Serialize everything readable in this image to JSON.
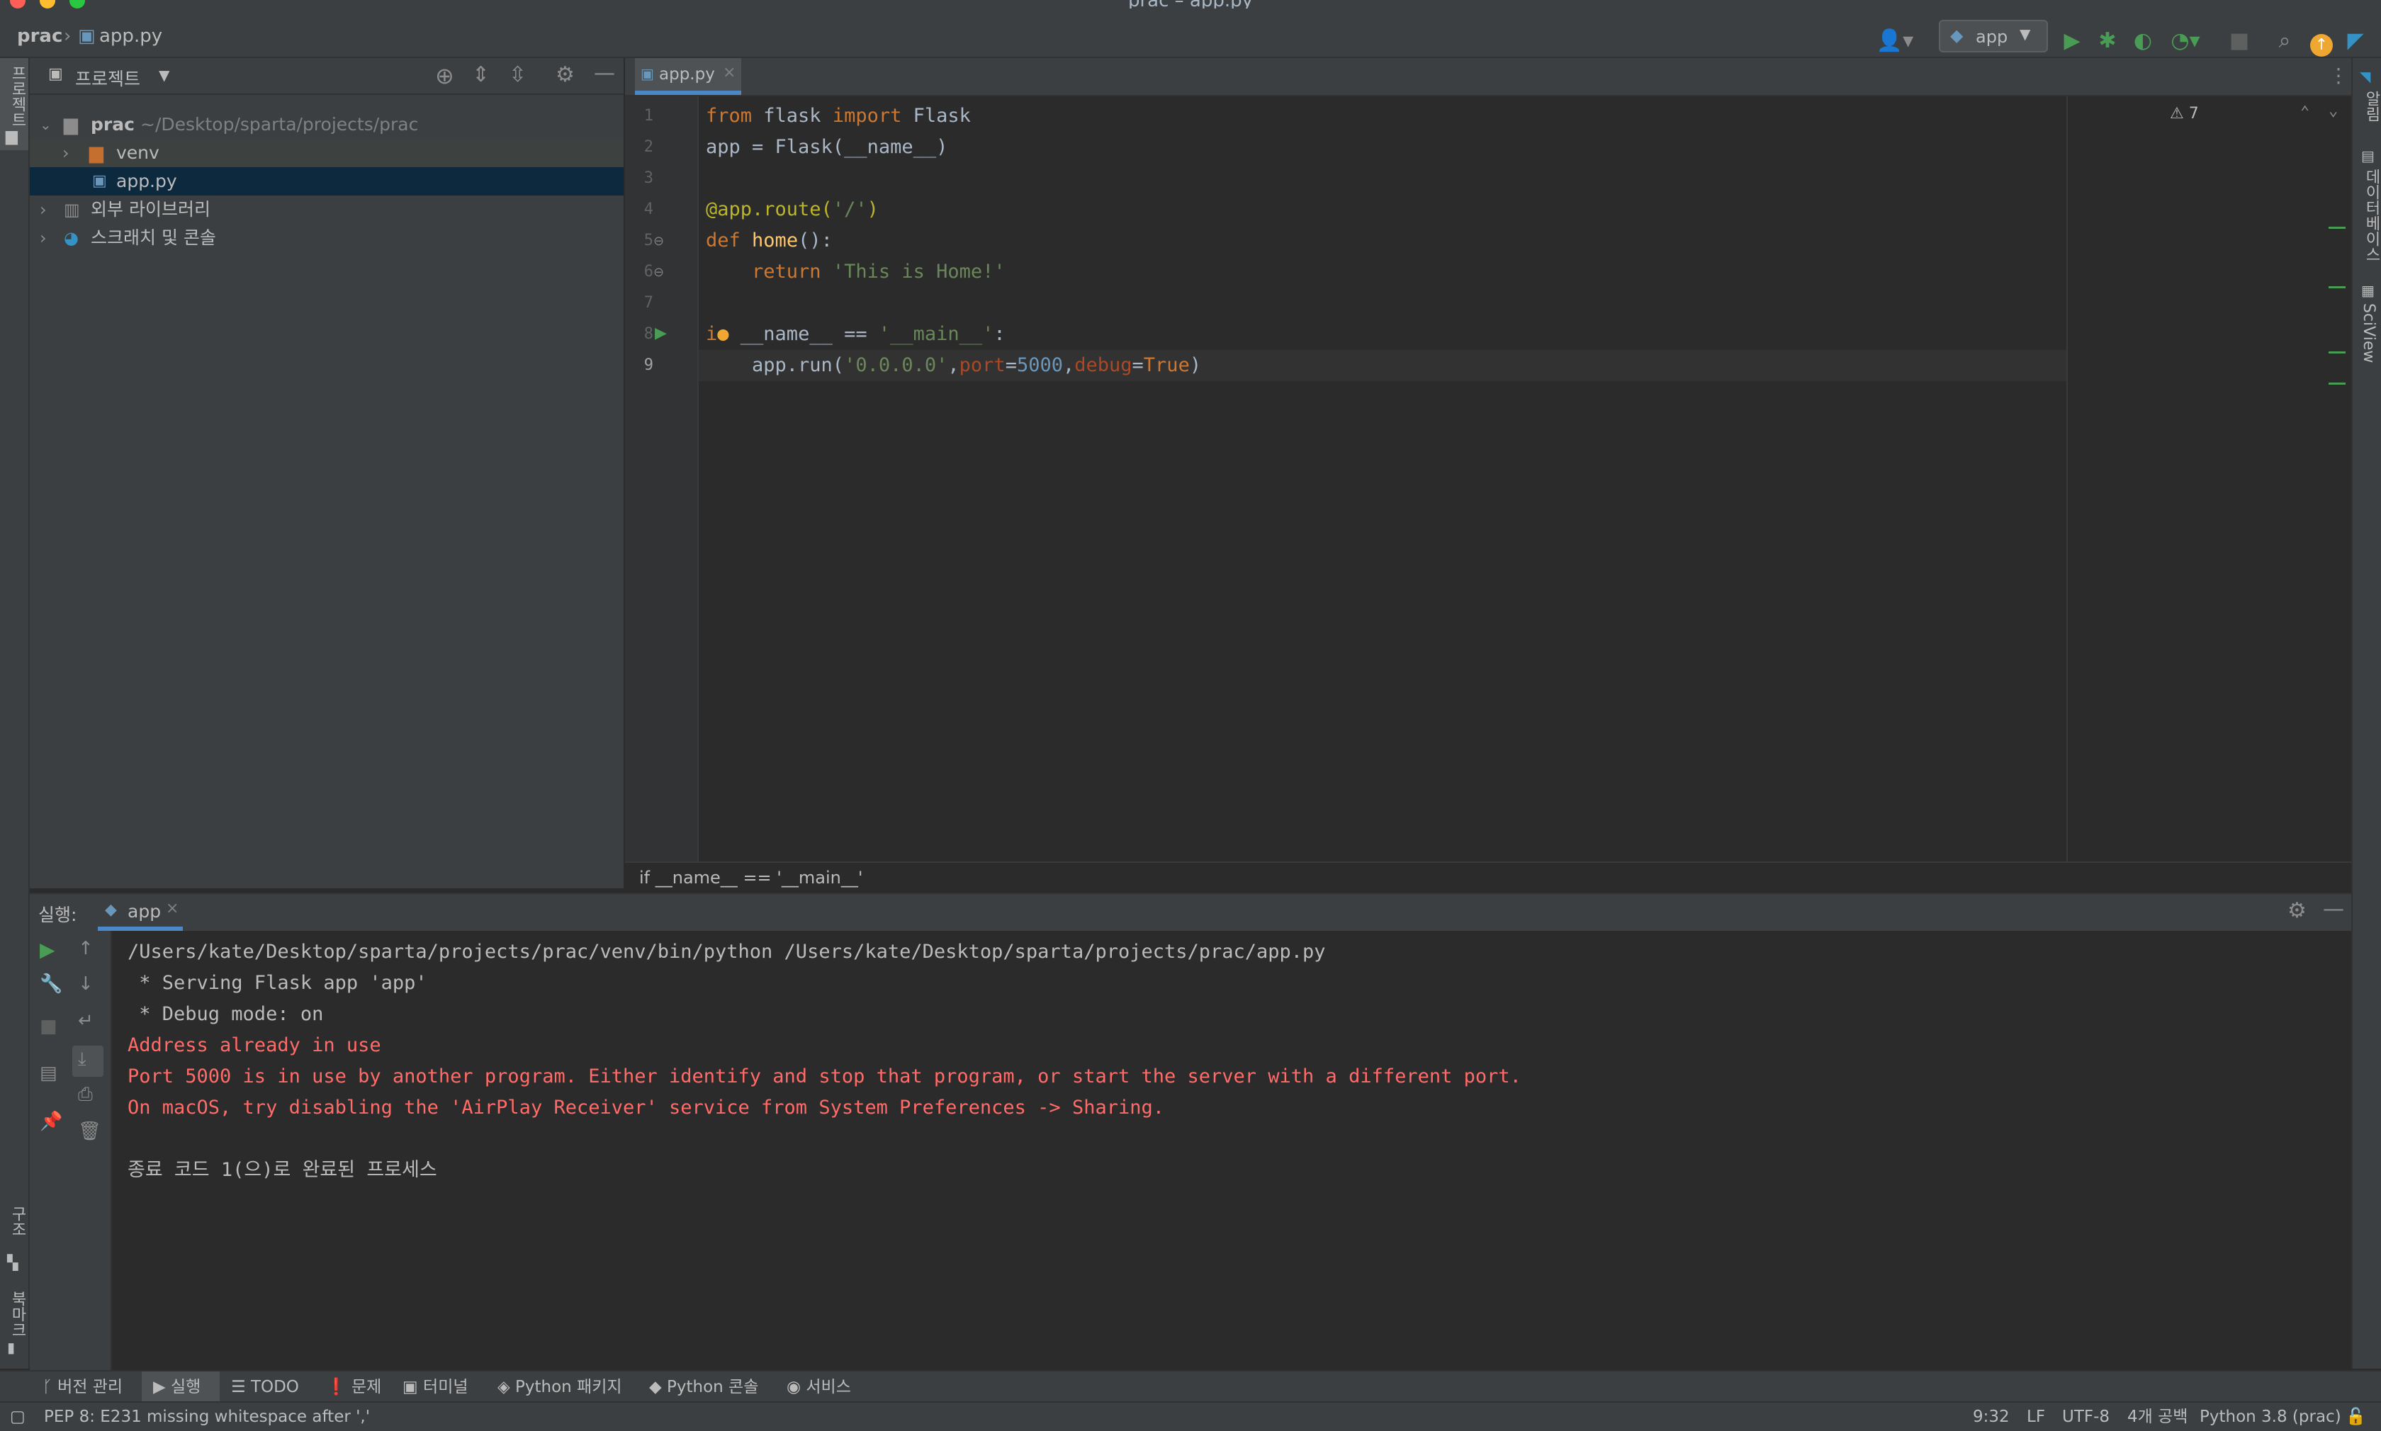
{
  "window": {
    "title": "prac – app.py"
  },
  "navbar": {
    "project": "prac",
    "file": "app.py",
    "run_config": "app"
  },
  "left_stripe": {
    "project_label": "프로젝트",
    "structure_label": "구조",
    "bookmarks_label": "북마크"
  },
  "right_stripe": {
    "notifications_label": "알림",
    "database_label": "데이터베이스",
    "sciview_label": "SciView"
  },
  "project_panel": {
    "title": "프로젝트",
    "tree": [
      {
        "label": "prac",
        "path": "~/Desktop/sparta/projects/prac"
      },
      {
        "label": "venv"
      },
      {
        "label": "app.py"
      },
      {
        "label": "외부 라이브러리"
      },
      {
        "label": "스크래치 및 콘솔"
      }
    ]
  },
  "editor": {
    "tab": "app.py",
    "warnings": "7",
    "line_numbers": [
      "1",
      "2",
      "3",
      "4",
      "5",
      "6",
      "7",
      "8",
      "9"
    ],
    "breadcrumb": "if __name__ == '__main__'"
  },
  "run_panel": {
    "label": "실행:",
    "tab": "app",
    "output": [
      {
        "text": "/Users/kate/Desktop/sparta/projects/prac/venv/bin/python /Users/kate/Desktop/sparta/projects/prac/app.py",
        "type": "normal"
      },
      {
        "text": " * Serving Flask app 'app'",
        "type": "normal"
      },
      {
        "text": " * Debug mode: on",
        "type": "normal"
      },
      {
        "text": "Address already in use",
        "type": "error"
      },
      {
        "text": "Port 5000 is in use by another program. Either identify and stop that program, or start the server with a different port.",
        "type": "error"
      },
      {
        "text": "On macOS, try disabling the 'AirPlay Receiver' service from System Preferences -> Sharing.",
        "type": "error"
      },
      {
        "text": "",
        "type": "normal"
      },
      {
        "text": "종료 코드 1(으)로 완료된 프로세스",
        "type": "normal"
      }
    ]
  },
  "bottom_tabs": [
    "버전 관리",
    "실행",
    "TODO",
    "문제",
    "터미널",
    "Python 패키지",
    "Python 콘솔",
    "서비스"
  ],
  "status": {
    "message": "PEP 8: E231 missing whitespace after ','",
    "position": "9:32",
    "line_sep": "LF",
    "encoding": "UTF-8",
    "indent": "4개 공백",
    "interpreter": "Python 3.8 (prac)"
  },
  "colors": {
    "accent_green": "#499c54",
    "error_red": "#ff6b68",
    "folder_orange": "#c46e2f"
  }
}
